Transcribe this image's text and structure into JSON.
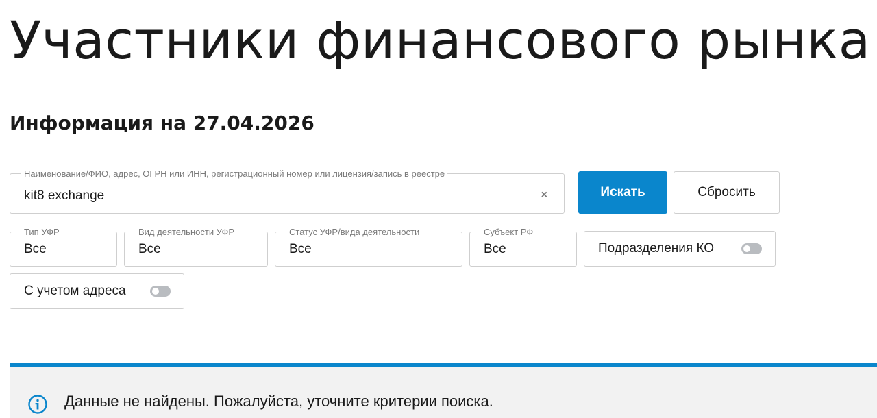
{
  "page": {
    "title": "Участники финансового рынка",
    "info_date": "Информация на 27.04.2026"
  },
  "search": {
    "label": "Наименование/ФИО, адрес, ОГРН или ИНН, регистрационный номер или лицензия/запись в реестре",
    "value": "kit8 exchange",
    "clear_icon": "close-icon",
    "clear_glyph": "×"
  },
  "buttons": {
    "search_label": "Искать",
    "reset_label": "Сбросить"
  },
  "filters": {
    "type": {
      "label": "Тип УФР",
      "value": "Все"
    },
    "activity": {
      "label": "Вид деятельности УФР",
      "value": "Все"
    },
    "status": {
      "label": "Статус УФР/вида деятельности",
      "value": "Все"
    },
    "region": {
      "label": "Субъект РФ",
      "value": "Все"
    }
  },
  "toggles": {
    "ko_divisions": {
      "label": "Подразделения КО",
      "on": false
    },
    "with_address": {
      "label": "С учетом адреса",
      "on": false
    }
  },
  "notice": {
    "icon": "info-icon",
    "text": "Данные не найдены. Пожалуйста, уточните критерии поиска."
  },
  "colors": {
    "accent": "#0a86cc",
    "notice_bg": "#f2f2f2",
    "toggle_off": "#b9bcc0"
  }
}
